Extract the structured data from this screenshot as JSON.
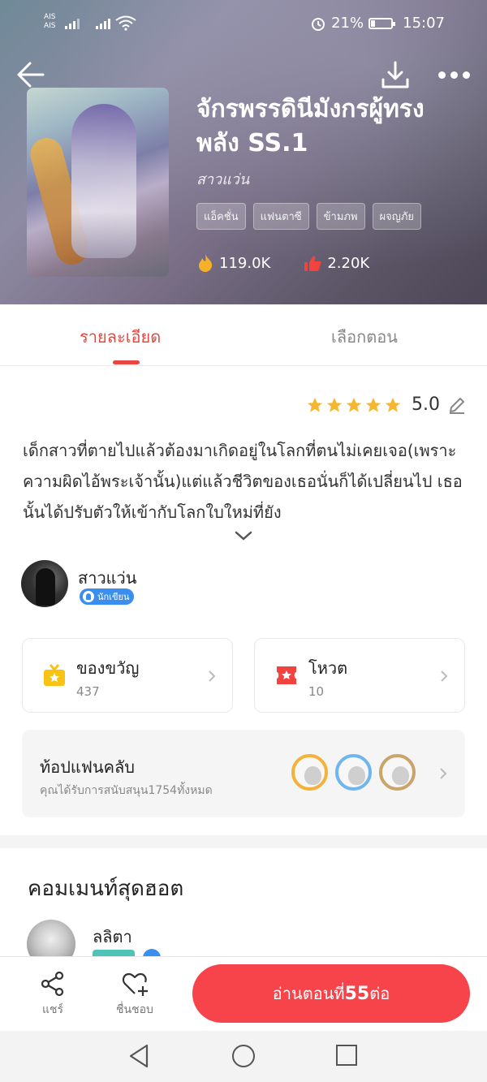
{
  "status_bar": {
    "carrier_1": "AIS",
    "carrier_2": "AIS",
    "battery": "21%",
    "time": "15:07"
  },
  "book": {
    "title": "จักรพรรดินีมังกรผู้ทรงพลัง SS.1",
    "author": "สาวแว่น",
    "tags": [
      "แอ็คชั่น",
      "แฟนตาซี",
      "ข้ามภพ",
      "ผจญภัย"
    ],
    "views": "119.0K",
    "likes": "2.20K"
  },
  "tabs": {
    "details": "รายละเอียด",
    "chapters": "เลือกตอน"
  },
  "rating": {
    "value": "5.0",
    "stars": 5
  },
  "description": "เด็กสาวที่ตายไปแล้วต้องมาเกิดอยู่ในโลกที่ตนไม่เคยเจอ(เพราะความผิดไอ้พระเจ้านั้น)แต่แล้วชีวิตของเธอนั่นก็ได้เปลี่ยนไป   เธอนั้นได้ปรับตัวให้เข้ากับโลกใบใหม่ที่ยัง",
  "author_info": {
    "name": "สาวแว่น",
    "badge": "นักเขียน"
  },
  "cards": {
    "gift_label": "ของขวัญ",
    "gift_count": "437",
    "vote_label": "โหวต",
    "vote_count": "10"
  },
  "fanclub": {
    "title": "ท้อปแฟนคลับ",
    "subtitle": "คุณได้รับการสนับสนุน1754ทั้งหมด"
  },
  "comments": {
    "section_title": "คอมเมนท์สุดฮอต",
    "first_user": "ลลิตา"
  },
  "bottom_bar": {
    "share": "แชร์",
    "favorite": "ชื่นชอบ",
    "read_prefix": "อ่านตอนที่",
    "read_number": "55",
    "read_suffix": "ต่อ"
  },
  "colors": {
    "accent": "#e8463f",
    "read_button": "#f7444b",
    "star": "#f5b731",
    "writer_badge": "#3a8ef0"
  },
  "icons": {
    "back": "back-arrow-icon",
    "download": "download-icon",
    "more": "more-dots-icon",
    "fire": "fire-icon",
    "thumbs_up": "thumbs-up-icon",
    "edit": "edit-pencil-icon",
    "gift": "gift-icon",
    "ticket": "ticket-icon",
    "share": "share-icon",
    "heart_plus": "heart-plus-icon"
  }
}
